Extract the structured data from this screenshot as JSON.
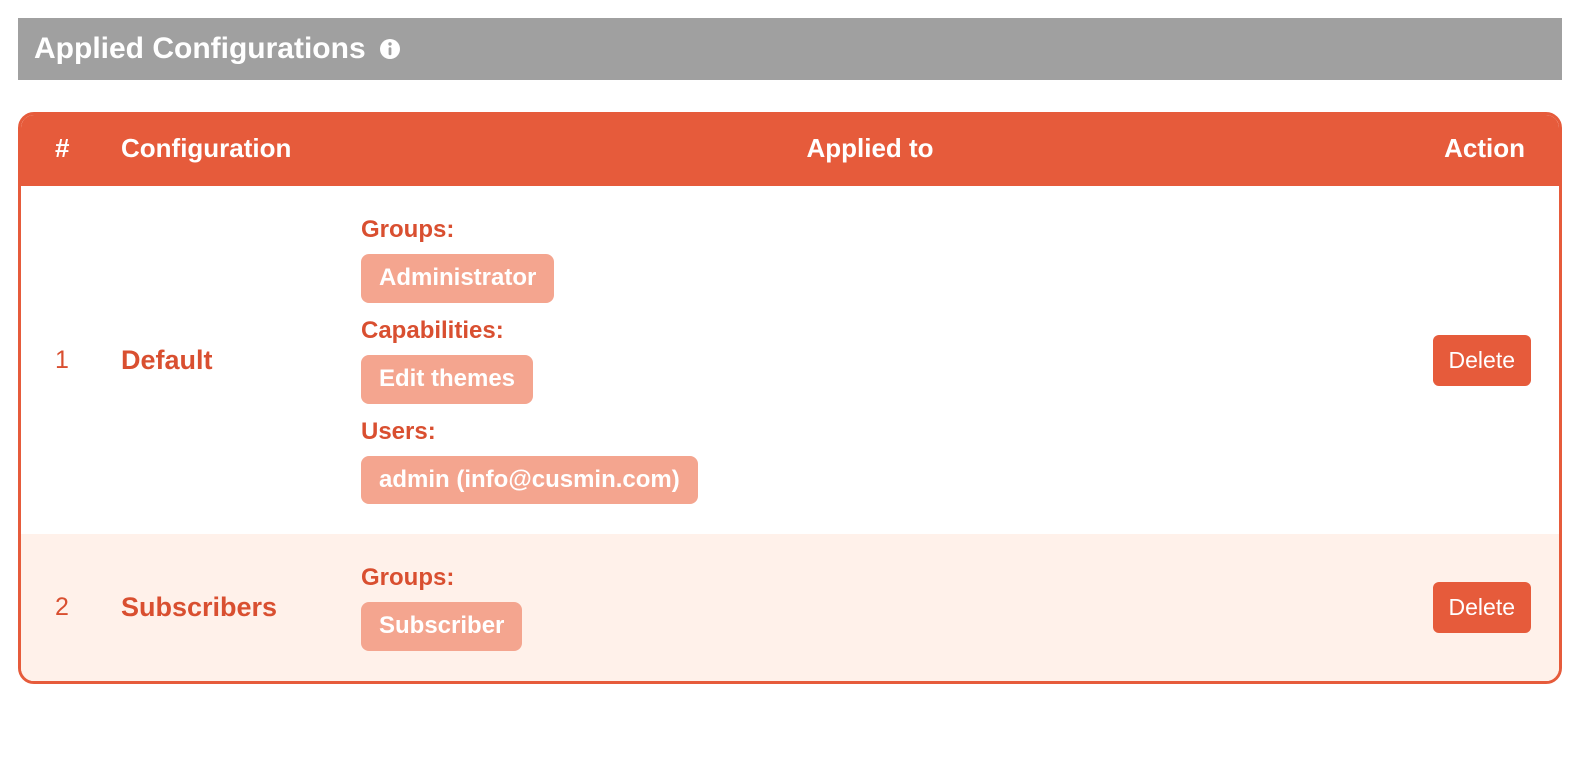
{
  "header": {
    "title": "Applied Configurations"
  },
  "table": {
    "columns": {
      "num": "#",
      "config": "Configuration",
      "applied": "Applied to",
      "action": "Action"
    },
    "rows": [
      {
        "num": "1",
        "name": "Default",
        "sections": [
          {
            "label": "Groups:",
            "tags": [
              "Administrator"
            ]
          },
          {
            "label": "Capabilities:",
            "tags": [
              "Edit themes"
            ]
          },
          {
            "label": "Users:",
            "tags": [
              "admin (info@cusmin.com)"
            ]
          }
        ],
        "action": "Delete"
      },
      {
        "num": "2",
        "name": "Subscribers",
        "sections": [
          {
            "label": "Groups:",
            "tags": [
              "Subscriber"
            ]
          }
        ],
        "action": "Delete"
      }
    ]
  }
}
